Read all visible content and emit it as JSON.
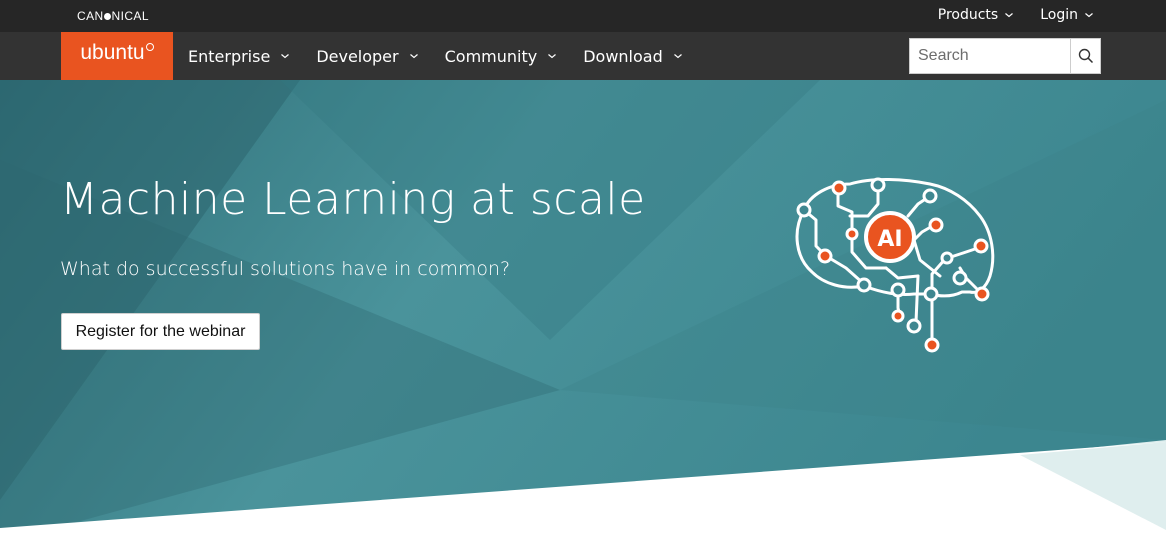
{
  "canonical_bar": {
    "logo_text_left": "CAN",
    "logo_text_right": "NICAL",
    "menu": [
      {
        "label": "Products"
      },
      {
        "label": "Login"
      }
    ]
  },
  "nav": {
    "logo": "ubuntu",
    "items": [
      {
        "label": "Enterprise"
      },
      {
        "label": "Developer"
      },
      {
        "label": "Community"
      },
      {
        "label": "Download"
      }
    ],
    "search": {
      "placeholder": "Search"
    }
  },
  "hero": {
    "title": "Machine Learning at scale",
    "subtitle": "What do successful solutions have in common?",
    "cta_label": "Register for the webinar",
    "illustration_badge": "AI"
  },
  "colors": {
    "ubuntu_orange": "#e95420",
    "hero_teal": "#3f8790",
    "nav_dark": "#333333",
    "top_bar": "#262626"
  }
}
